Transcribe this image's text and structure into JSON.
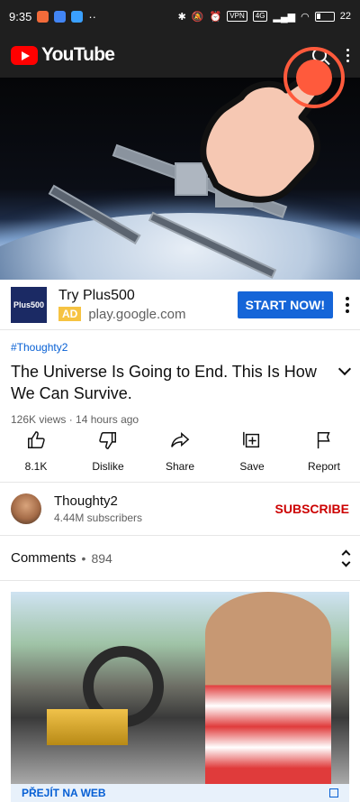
{
  "status_bar": {
    "time": "9:35",
    "battery": "22",
    "network": "4G"
  },
  "app_bar": {
    "brand": "YouTube"
  },
  "ad": {
    "logo_text": "Plus500",
    "title": "Try Plus500",
    "badge": "AD",
    "domain": "play.google.com",
    "cta": "START NOW!"
  },
  "video": {
    "hashtag": "#Thoughty2",
    "title": "The Universe Is Going to End. This Is How We Can Survive.",
    "meta": "126K views · 14 hours ago"
  },
  "actions": [
    {
      "label": "8.1K",
      "icon": "thumb-up-icon"
    },
    {
      "label": "Dislike",
      "icon": "thumb-down-icon"
    },
    {
      "label": "Share",
      "icon": "share-icon"
    },
    {
      "label": "Save",
      "icon": "save-icon"
    },
    {
      "label": "Report",
      "icon": "flag-icon"
    }
  ],
  "channel": {
    "name": "Thoughty2",
    "subscribers": "4.44M subscribers",
    "subscribe_label": "SUBSCRIBE"
  },
  "comments": {
    "label": "Comments",
    "count": "894"
  },
  "ad_card": {
    "cta": "PŘEJÍT NA WEB"
  },
  "colors": {
    "accent_red": "#cc0000",
    "link_blue": "#065fd4",
    "cta_blue": "#1565d8",
    "tap_overlay": "#ff5a3c"
  }
}
